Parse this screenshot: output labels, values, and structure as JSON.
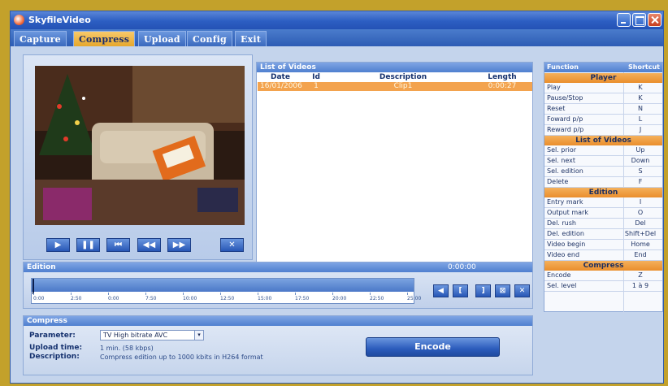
{
  "window": {
    "title": "SkyfileVideo"
  },
  "menu": {
    "items": [
      "Capture",
      "Compress",
      "Upload",
      "Config",
      "Exit"
    ],
    "active": "Compress"
  },
  "player": {
    "controls": [
      "play",
      "pause",
      "reset",
      "reward",
      "forward",
      "delete"
    ],
    "control_glyphs": [
      "▶",
      "❚❚",
      "⏮",
      "◀◀",
      "▶▶",
      "✕"
    ]
  },
  "videos": {
    "title": "List of Videos",
    "columns": [
      "Date",
      "Id",
      "Description",
      "Length"
    ],
    "rows": [
      {
        "date": "16/01/2006",
        "id": "1",
        "description": "Clip1",
        "length": "0:00:27"
      }
    ]
  },
  "edition": {
    "title": "Edition",
    "timecode": "0:00:00",
    "ticks": [
      "0:00",
      "2:50",
      "0:00",
      "7:50",
      "10:00",
      "12:50",
      "15:00",
      "17:50",
      "20:00",
      "22:50",
      "25:00"
    ],
    "buttons": [
      "◀",
      "[",
      "]",
      "⊠",
      "✕"
    ]
  },
  "compress": {
    "title": "Compress",
    "parameter_label": "Parameter:",
    "parameter_value": "TV High bitrate AVC",
    "upload_label": "Upload time:",
    "upload_value": "1 min. (58 kbps)",
    "description_label": "Description:",
    "description_value": "Compress edition up to 1000 kbits in H264 format",
    "encode_label": "Encode"
  },
  "shortcuts": {
    "header_function": "Function",
    "header_shortcut": "Shortcut",
    "sections": [
      {
        "title": "Player",
        "rows": [
          {
            "fn": "Play",
            "key": "K"
          },
          {
            "fn": "Pause/Stop",
            "key": "K"
          },
          {
            "fn": "Reset",
            "key": "N"
          },
          {
            "fn": "Foward p/p",
            "key": "L"
          },
          {
            "fn": "Reward p/p",
            "key": "J"
          }
        ]
      },
      {
        "title": "List of Videos",
        "rows": [
          {
            "fn": "Sel. prior",
            "key": "Up"
          },
          {
            "fn": "Sel. next",
            "key": "Down"
          },
          {
            "fn": "Sel. edition",
            "key": "S"
          },
          {
            "fn": "Delete",
            "key": "F"
          }
        ]
      },
      {
        "title": "Edition",
        "rows": [
          {
            "fn": "Entry mark",
            "key": "I"
          },
          {
            "fn": "Output mark",
            "key": "O"
          },
          {
            "fn": "Del. rush",
            "key": "Del"
          },
          {
            "fn": "Del. edition",
            "key": "Shift+Del"
          },
          {
            "fn": "Video begin",
            "key": "Home"
          },
          {
            "fn": "Video end",
            "key": "End"
          }
        ]
      },
      {
        "title": "Compress",
        "rows": [
          {
            "fn": "Encode",
            "key": "Z"
          },
          {
            "fn": "Sel. level",
            "key": "1 à 9"
          }
        ]
      }
    ]
  },
  "colors": {
    "accent": "#f3a34e",
    "primary": "#2c5ec2",
    "background": "#c4d4ec"
  }
}
